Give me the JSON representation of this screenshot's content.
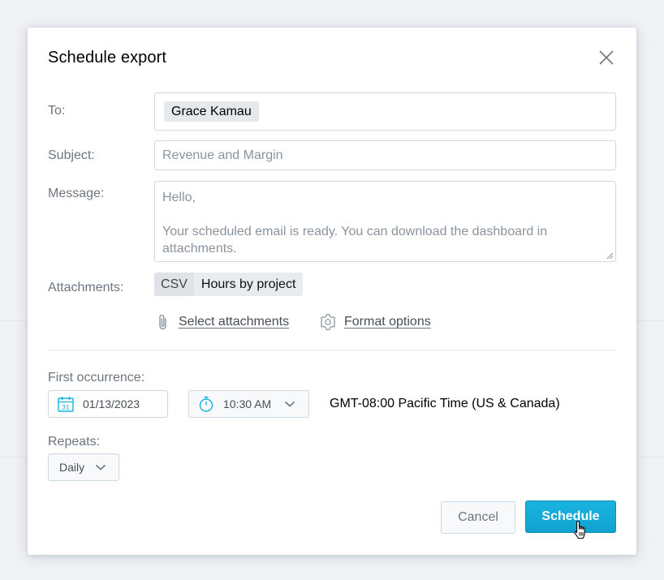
{
  "dialog": {
    "title": "Schedule export",
    "close_icon": "close-icon"
  },
  "form": {
    "to_label": "To:",
    "to_recipient": "Grace Kamau",
    "subject_label": "Subject:",
    "subject_placeholder": "Revenue and Margin",
    "message_label": "Message:",
    "message_line1": "Hello,",
    "message_line2": "Your scheduled email is ready. You can download the dashboard in attachments.",
    "attachments_label": "Attachments:",
    "attachment_type": "CSV",
    "attachment_name": "Hours by project",
    "select_attachments": "Select attachments",
    "format_options": "Format options"
  },
  "schedule": {
    "first_occurrence_label": "First occurrence:",
    "date": "01/13/2023",
    "time": "10:30 AM",
    "timezone": "GMT-08:00 Pacific Time (US & Canada)",
    "repeats_label": "Repeats:",
    "repeats_value": "Daily"
  },
  "actions": {
    "cancel": "Cancel",
    "schedule": "Schedule"
  },
  "colors": {
    "primary": "#14b2e2",
    "label": "#6d7680",
    "border": "#ccd8e2"
  }
}
